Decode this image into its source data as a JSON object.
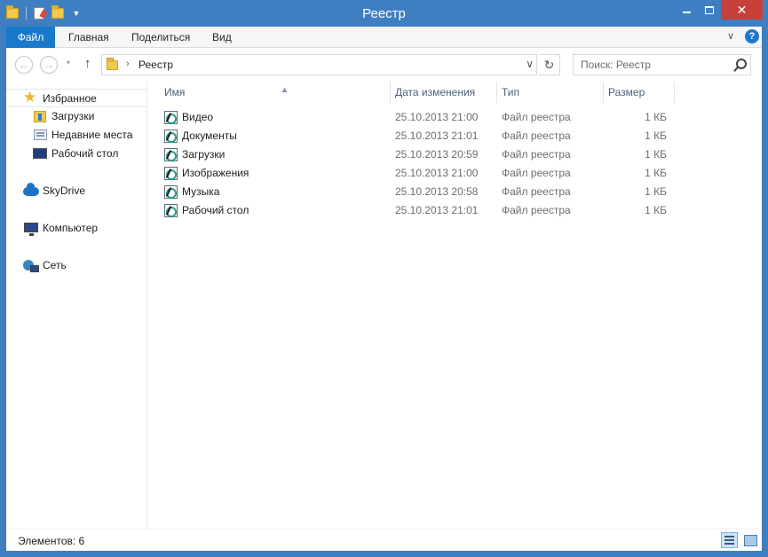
{
  "window": {
    "title": "Реестр",
    "close_glyph": "✕"
  },
  "ribbon": {
    "tabs": [
      {
        "label": "Файл",
        "active": true
      },
      {
        "label": "Главная"
      },
      {
        "label": "Поделиться"
      },
      {
        "label": "Вид"
      }
    ],
    "expand_glyph": "∨",
    "help_glyph": "?"
  },
  "address_bar": {
    "back_glyph": "←",
    "forward_glyph": "→",
    "history_glyph": "▾",
    "up_glyph": "↑",
    "separator_glyph": "›",
    "path": "Реестр",
    "dropdown_glyph": "∨",
    "refresh_glyph": "↻"
  },
  "search": {
    "placeholder": "Поиск: Реестр"
  },
  "nav_pane": {
    "favorites": {
      "label": "Избранное",
      "icon": "star-icon"
    },
    "favorites_items": [
      {
        "label": "Загрузки",
        "icon": "downloads-icon"
      },
      {
        "label": "Недавние места",
        "icon": "recent-places-icon"
      },
      {
        "label": "Рабочий стол",
        "icon": "desktop-icon"
      }
    ],
    "skydrive": {
      "label": "SkyDrive",
      "icon": "cloud-icon"
    },
    "computer": {
      "label": "Компьютер",
      "icon": "computer-icon"
    },
    "network": {
      "label": "Сеть",
      "icon": "network-icon"
    }
  },
  "file_list": {
    "sort_glyph": "▲",
    "columns": {
      "name": "Имя",
      "date": "Дата изменения",
      "type": "Тип",
      "size": "Размер"
    },
    "rows": [
      {
        "name": "Видео",
        "date": "25.10.2013 21:00",
        "type": "Файл реестра",
        "size": "1 КБ"
      },
      {
        "name": "Документы",
        "date": "25.10.2013 21:01",
        "type": "Файл реестра",
        "size": "1 КБ"
      },
      {
        "name": "Загрузки",
        "date": "25.10.2013 20:59",
        "type": "Файл реестра",
        "size": "1 КБ"
      },
      {
        "name": "Изображения",
        "date": "25.10.2013 21:00",
        "type": "Файл реестра",
        "size": "1 КБ"
      },
      {
        "name": "Музыка",
        "date": "25.10.2013 20:58",
        "type": "Файл реестра",
        "size": "1 КБ"
      },
      {
        "name": "Рабочий стол",
        "date": "25.10.2013 21:01",
        "type": "Файл реестра",
        "size": "1 КБ"
      }
    ]
  },
  "status_bar": {
    "item_count": "Элементов: 6"
  },
  "colors": {
    "frame": "#3f7fc1",
    "file_tab": "#1979ca",
    "close_button": "#c7413a",
    "column_header_text": "#4c607a"
  }
}
